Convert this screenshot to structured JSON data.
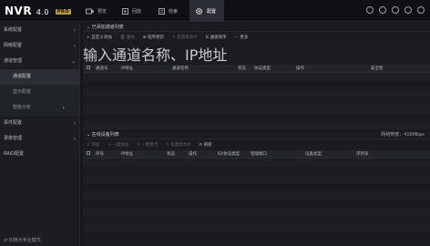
{
  "topbar": {
    "logo": "NVR",
    "version": "4.0",
    "badge": "PRO",
    "tabs": [
      {
        "label": "预览",
        "icon": "camera-icon",
        "active": false
      },
      {
        "label": "回放",
        "icon": "playback-icon",
        "active": false
      },
      {
        "label": "检索",
        "icon": "search-icon",
        "active": false
      },
      {
        "label": "配置",
        "icon": "gear-icon",
        "active": true
      }
    ]
  },
  "sidebar": {
    "items": [
      {
        "label": "系统配置"
      },
      {
        "label": "网络配置"
      },
      {
        "label": "通道管理"
      }
    ],
    "subitems": [
      {
        "label": "通道配置"
      },
      {
        "label": "显示配置"
      },
      {
        "label": "智能分析"
      }
    ],
    "items2": [
      {
        "label": "事件配置"
      },
      {
        "label": "录像管理"
      },
      {
        "label": "RAID配置"
      }
    ],
    "bottom": "切换为专业模式"
  },
  "panel1": {
    "title": "已添加通道列表",
    "toolbar": [
      "自定义添加",
      "删除",
      "程序更新",
      "批量修改IP",
      "通道排序",
      "更多"
    ],
    "search_placeholder": "输入通道名称、IP地址",
    "columns": [
      "通道号",
      "IP地址",
      "通道名称",
      "状态",
      "协议类型",
      "操作",
      "安全性"
    ]
  },
  "panel2": {
    "title": "在线设备列表",
    "right": "网络带宽：416Mbps",
    "toolbar": [
      "添加",
      "一键添加",
      "一键激活",
      "批量修改IP",
      "刷新"
    ],
    "columns": [
      "序号",
      "IP地址",
      "状态",
      "操作",
      "ID/协议类型",
      "管理端口",
      "设备类型",
      "序列号"
    ]
  }
}
